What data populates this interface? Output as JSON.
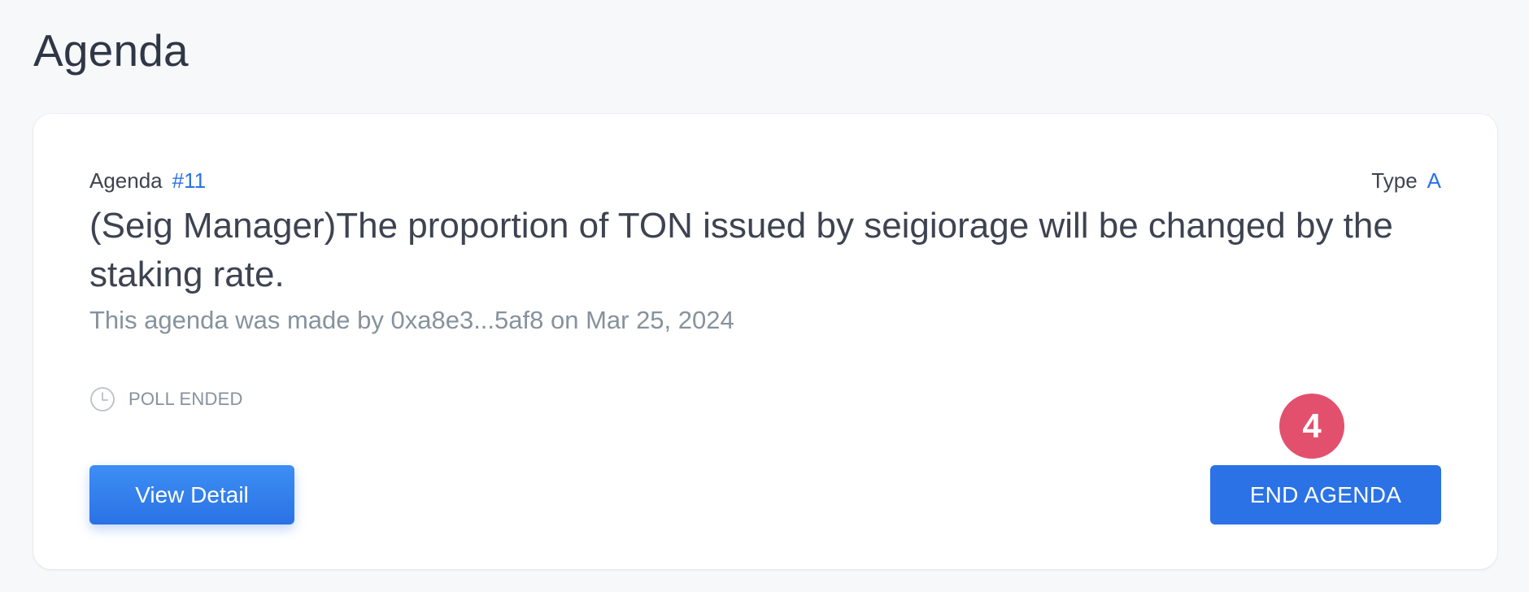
{
  "page": {
    "title": "Agenda"
  },
  "agenda_card": {
    "agenda_label": "Agenda",
    "agenda_number": "#11",
    "type_label": "Type",
    "type_value": "A",
    "title": "(Seig Manager)The proportion of TON issued by seigiorage will be changed by the staking rate.",
    "subtitle": "This agenda was made by 0xa8e3...5af8 on Mar 25, 2024",
    "status_icon": "clock-icon",
    "status": "POLL ENDED",
    "view_detail_label": "View Detail",
    "end_agenda_label": "END AGENDA"
  },
  "annotation": {
    "step_number": "4"
  },
  "colors": {
    "accent": "#2a72e5",
    "badge": "#e2506e",
    "background": "#f7f8fa",
    "text": "#3d4350",
    "muted": "#86929d"
  }
}
